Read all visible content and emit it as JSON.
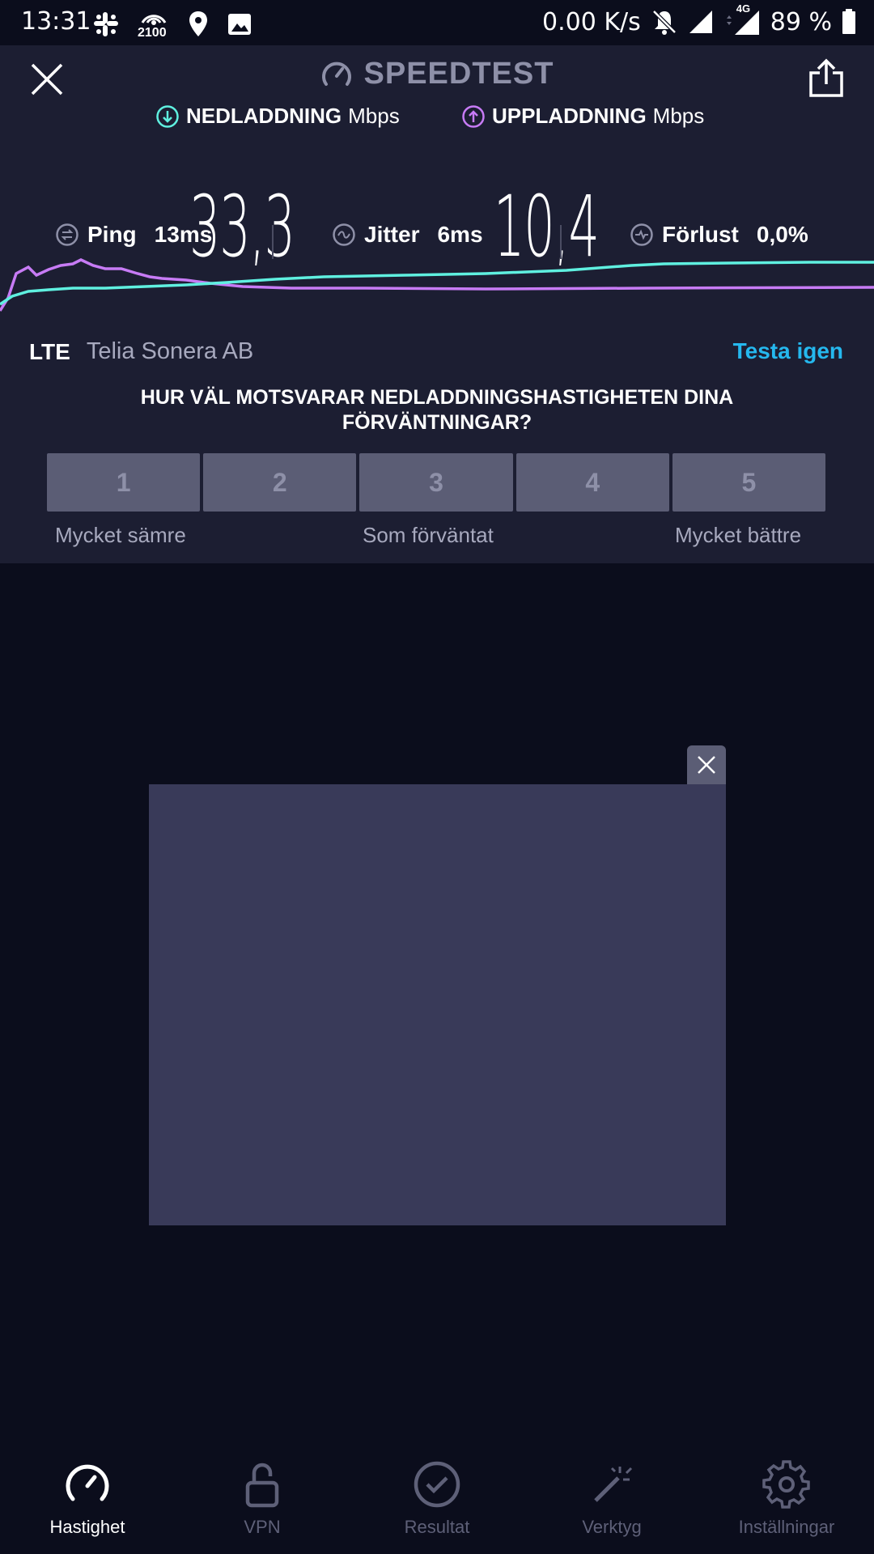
{
  "status_bar": {
    "time": "13:31",
    "network_badge": "2100",
    "net_speed": "0.00 K/s",
    "signal_badge": "4G",
    "battery": "89 %",
    "icons": [
      "slack-icon",
      "hotspot-icon",
      "location-icon",
      "image-icon",
      "mute-icon",
      "signal-icon",
      "signal-4g-icon",
      "battery-icon"
    ]
  },
  "header": {
    "title": "SPEEDTEST",
    "close_icon": "close-icon",
    "share_icon": "share-icon"
  },
  "download": {
    "label": "NEDLADDNING",
    "unit": "Mbps",
    "value": "33,3",
    "color": "#5ff0e0"
  },
  "upload": {
    "label": "UPPLADDNING",
    "unit": "Mbps",
    "value": "10,4",
    "color": "#c77bf5"
  },
  "stats": {
    "ping": {
      "label": "Ping",
      "value": "13ms"
    },
    "jitter": {
      "label": "Jitter",
      "value": "6ms"
    },
    "loss": {
      "label": "Förlust",
      "value": "0,0%"
    }
  },
  "connection": {
    "tech": "LTE",
    "provider": "Telia Sonera AB",
    "retest": "Testa igen"
  },
  "survey": {
    "question": "HUR VÄL MOTSVARAR NEDLADDNINGSHASTIGHETEN DINA FÖRVÄNTNINGAR?",
    "options": [
      "1",
      "2",
      "3",
      "4",
      "5"
    ],
    "low_label": "Mycket sämre",
    "mid_label": "Som förväntat",
    "high_label": "Mycket bättre"
  },
  "nav": {
    "items": [
      {
        "label": "Hastighet",
        "icon": "speedometer-icon",
        "active": true
      },
      {
        "label": "VPN",
        "icon": "unlock-icon",
        "active": false
      },
      {
        "label": "Resultat",
        "icon": "check-circle-icon",
        "active": false
      },
      {
        "label": "Verktyg",
        "icon": "magic-wand-icon",
        "active": false
      },
      {
        "label": "Inställningar",
        "icon": "gear-icon",
        "active": false
      }
    ]
  },
  "colors": {
    "accent": "#25b8ee",
    "panel": "#1c1e32",
    "background": "#0b0d1c"
  }
}
